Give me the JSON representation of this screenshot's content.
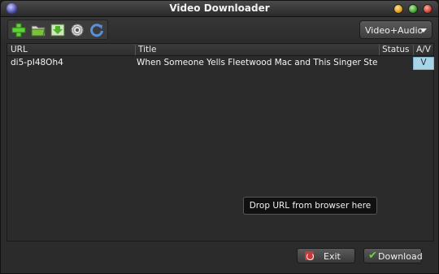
{
  "window": {
    "title": "Video Downloader"
  },
  "toolbar": {
    "mode": {
      "selected": "Video+Audio"
    },
    "icons": [
      "add-icon",
      "open-folder-icon",
      "save-download-icon",
      "gear-icon",
      "refresh-icon"
    ]
  },
  "table": {
    "columns": [
      "URL",
      "Title",
      "Status",
      "A/V"
    ],
    "rows": [
      {
        "url": "di5-pI48Oh4",
        "title": "When Someone Yells Fleetwood Mac and This Singer Steal",
        "status": "",
        "av": "V"
      }
    ]
  },
  "drop_hint": "Drop URL from browser here",
  "buttons": {
    "exit": "Exit",
    "download": "Download"
  },
  "colors": {
    "accent_cell": "#a8d4e6",
    "check": "#6bd14a",
    "exit": "#c83a3a"
  }
}
